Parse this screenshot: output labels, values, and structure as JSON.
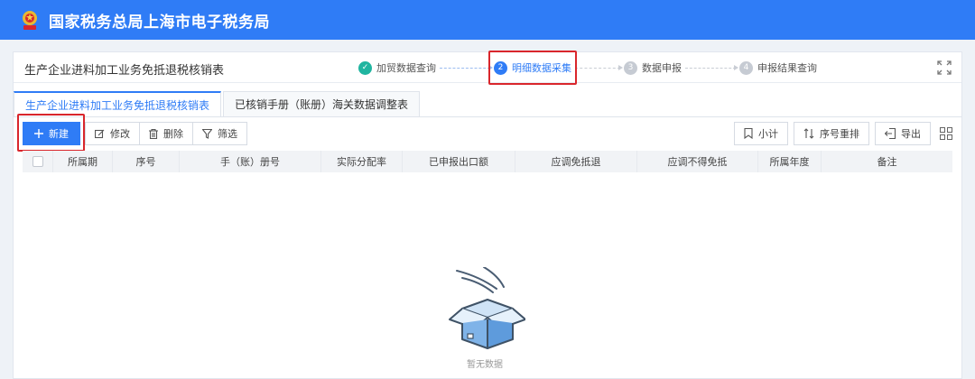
{
  "header": {
    "site_title": "国家税务总局上海市电子税务局",
    "emblem_icon": "tax-emblem-icon"
  },
  "titlebar": {
    "heading": "生产企业进料加工业务免抵退税核销表",
    "expand_icon": "fullscreen-icon"
  },
  "steps": [
    {
      "number": "✓",
      "label": "加贸数据查询",
      "status": "done"
    },
    {
      "number": "2",
      "label": "明细数据采集",
      "status": "active"
    },
    {
      "number": "3",
      "label": "数据申报",
      "status": "todo"
    },
    {
      "number": "4",
      "label": "申报结果查询",
      "status": "todo"
    }
  ],
  "tabs": [
    {
      "label": "生产企业进料加工业务免抵退税核销表",
      "active": true
    },
    {
      "label": "已核销手册（账册）海关数据调整表",
      "active": false
    }
  ],
  "toolbar": {
    "new_label": "新建",
    "edit_label": "修改",
    "delete_label": "删除",
    "filter_label": "筛选",
    "subtotal_label": "小计",
    "renumber_label": "序号重排",
    "export_label": "导出"
  },
  "table": {
    "columns": [
      "所属期",
      "序号",
      "手（账）册号",
      "实际分配率",
      "已申报出口额",
      "应调免抵退",
      "应调不得免抵",
      "所属年度",
      "备注"
    ]
  },
  "empty_state": {
    "text": "暂无数据"
  },
  "colors": {
    "brand": "#2f7cf6",
    "done": "#20b5a0",
    "highlight": "#d9262c"
  }
}
